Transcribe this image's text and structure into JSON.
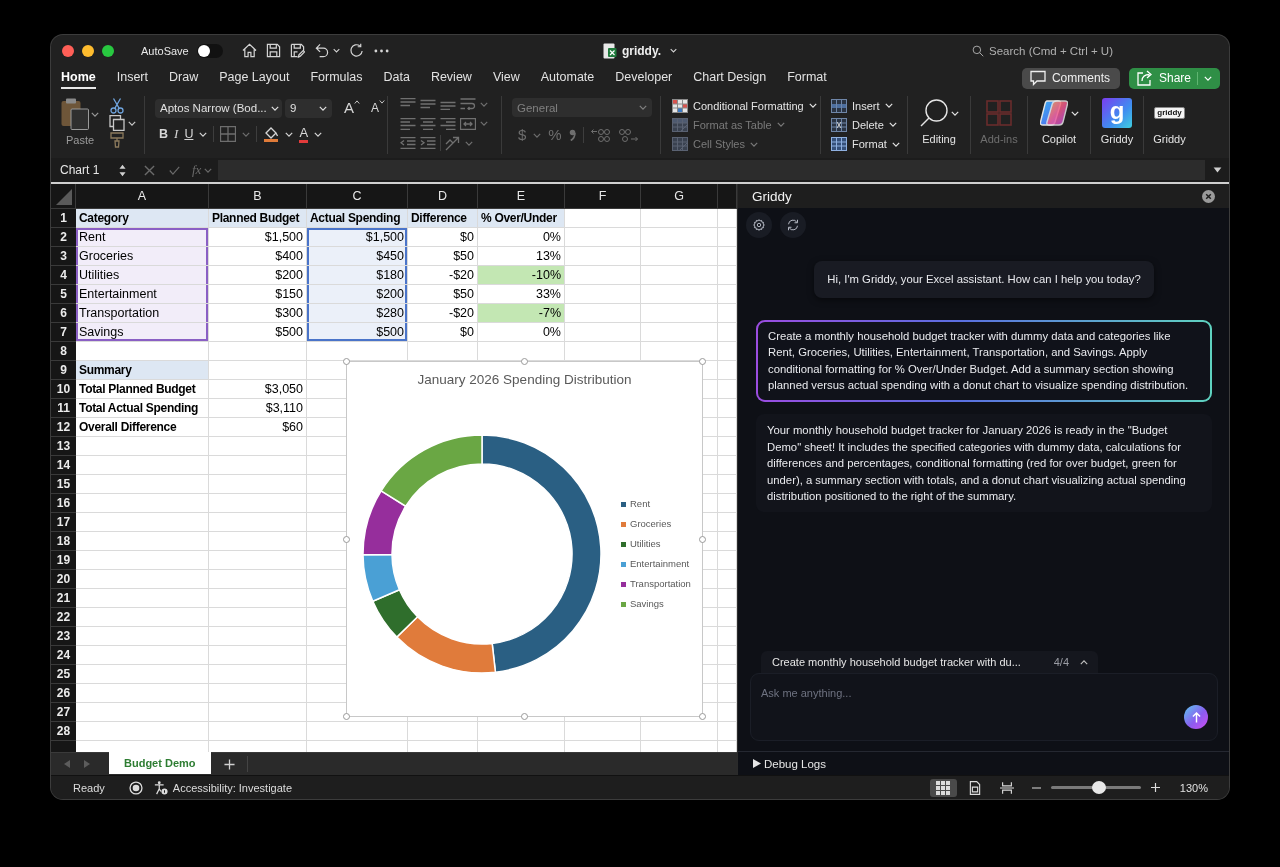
{
  "window": {
    "autosave": {
      "label": "AutoSave",
      "on": false
    },
    "file_name": "griddy.",
    "search": {
      "placeholder": "Search (Cmd + Ctrl + U)"
    }
  },
  "tabs": [
    {
      "label": "Home",
      "selected": true
    },
    {
      "label": "Insert",
      "selected": false
    },
    {
      "label": "Draw",
      "selected": false
    },
    {
      "label": "Page Layout",
      "selected": false
    },
    {
      "label": "Formulas",
      "selected": false
    },
    {
      "label": "Data",
      "selected": false
    },
    {
      "label": "Review",
      "selected": false
    },
    {
      "label": "View",
      "selected": false
    },
    {
      "label": "Automate",
      "selected": false
    },
    {
      "label": "Developer",
      "selected": false
    },
    {
      "label": "Chart Design",
      "selected": false
    },
    {
      "label": "Format",
      "selected": false
    }
  ],
  "header_buttons": {
    "comments": "Comments",
    "share": "Share"
  },
  "ribbon": {
    "clipboard": {
      "paste": "Paste"
    },
    "font": {
      "name": "Aptos Narrow (Bod...",
      "size": "9",
      "grow": "A",
      "shrink": "A",
      "bold": "B",
      "italic": "I",
      "underline": "U",
      "font_color": "A"
    },
    "alignment": {
      "disabled": true
    },
    "number": {
      "format": "General",
      "currency": "$",
      "percent": "%",
      "disabled": true
    },
    "styles": [
      {
        "kind": "conditional",
        "label": "Conditional Formatting",
        "disabled": false
      },
      {
        "kind": "table",
        "label": "Format as Table",
        "disabled": true
      },
      {
        "kind": "cell_styles",
        "label": "Cell Styles",
        "disabled": true
      }
    ],
    "cells": [
      {
        "kind": "insert",
        "label": "Insert"
      },
      {
        "kind": "delete",
        "label": "Delete"
      },
      {
        "kind": "format",
        "label": "Format"
      }
    ],
    "large_buttons": [
      {
        "kind": "editing",
        "label": "Editing",
        "disabled": false
      },
      {
        "kind": "addins",
        "label": "Add-ins",
        "disabled": true
      },
      {
        "kind": "copilot",
        "label": "Copilot",
        "disabled": false
      },
      {
        "kind": "tile",
        "label": "Griddy",
        "tile_letter": "g",
        "disabled": false
      },
      {
        "kind": "logo",
        "label": "Griddy",
        "logo_text": "griddy",
        "disabled": false
      }
    ]
  },
  "formula_bar": {
    "name_box": "Chart 1",
    "function_label": "fx"
  },
  "sheet": {
    "columns": [
      {
        "label": "A",
        "color": "#8a5fc4"
      },
      {
        "label": "B"
      },
      {
        "label": "C",
        "color": "#4a74c9"
      },
      {
        "label": "D"
      },
      {
        "label": "E"
      },
      {
        "label": "F"
      },
      {
        "label": "G"
      }
    ],
    "rows": [
      {
        "number": "1",
        "kind": "header",
        "cells": [
          "Category",
          "Planned Budget",
          "Actual Spending",
          "Difference",
          "% Over/Under"
        ]
      },
      {
        "number": "2",
        "kind": "data",
        "cells": [
          "Rent",
          "$1,500",
          "$1,500",
          "$0",
          "0%"
        ],
        "under_budget": false
      },
      {
        "number": "3",
        "kind": "data",
        "cells": [
          "Groceries",
          "$400",
          "$450",
          "$50",
          "13%"
        ],
        "under_budget": false
      },
      {
        "number": "4",
        "kind": "data",
        "cells": [
          "Utilities",
          "$200",
          "$180",
          "-$20",
          "-10%"
        ],
        "under_budget": true
      },
      {
        "number": "5",
        "kind": "data",
        "cells": [
          "Entertainment",
          "$150",
          "$200",
          "$50",
          "33%"
        ],
        "under_budget": false
      },
      {
        "number": "6",
        "kind": "data",
        "cells": [
          "Transportation",
          "$300",
          "$280",
          "-$20",
          "-7%"
        ],
        "under_budget": true
      },
      {
        "number": "7",
        "kind": "data",
        "cells": [
          "Savings",
          "$500",
          "$500",
          "$0",
          "0%"
        ],
        "under_budget": false
      },
      {
        "number": "8",
        "kind": "blank"
      },
      {
        "number": "9",
        "kind": "section",
        "cells": [
          "Summary"
        ]
      },
      {
        "number": "10",
        "kind": "total",
        "cells": [
          "Total Planned Budget",
          "$3,050"
        ]
      },
      {
        "number": "11",
        "kind": "total",
        "cells": [
          "Total Actual Spending",
          "$3,110"
        ]
      },
      {
        "number": "12",
        "kind": "total",
        "cells": [
          "Overall Difference",
          "$60"
        ]
      },
      {
        "number": "13",
        "kind": "blank"
      },
      {
        "number": "14",
        "kind": "blank"
      },
      {
        "number": "15",
        "kind": "blank"
      },
      {
        "number": "16",
        "kind": "blank"
      },
      {
        "number": "17",
        "kind": "blank"
      },
      {
        "number": "18",
        "kind": "blank"
      },
      {
        "number": "19",
        "kind": "blank"
      },
      {
        "number": "20",
        "kind": "blank"
      },
      {
        "number": "21",
        "kind": "blank"
      },
      {
        "number": "22",
        "kind": "blank"
      },
      {
        "number": "23",
        "kind": "blank"
      },
      {
        "number": "24",
        "kind": "blank"
      },
      {
        "number": "25",
        "kind": "blank"
      },
      {
        "number": "26",
        "kind": "blank"
      },
      {
        "number": "27",
        "kind": "blank"
      },
      {
        "number": "28",
        "kind": "blank"
      },
      {
        "kind": "blank"
      }
    ],
    "chart": {
      "chart_data": {
        "type": "donut",
        "title": "January 2026 Spending Distribution",
        "categories": [
          "Rent",
          "Groceries",
          "Utilities",
          "Entertainment",
          "Transportation",
          "Savings"
        ],
        "values": [
          48.2,
          14.5,
          5.8,
          6.4,
          9.0,
          16.1
        ],
        "colors": [
          "#2a5f83",
          "#e07b3b",
          "#2f6e2c",
          "#4aa0d5",
          "#962e9c",
          "#6aa744"
        ],
        "legend": "right"
      }
    }
  },
  "sheet_tabs": [
    {
      "label": "Budget Demo",
      "selected": true
    }
  ],
  "assistant": {
    "title": "Griddy",
    "messages": [
      {
        "kind": "greeting",
        "text": "Hi, I'm Griddy, your Excel assistant. How can I help you today?"
      },
      {
        "kind": "user",
        "text": "Create a monthly household budget tracker with dummy data and categories like Rent, Groceries, Utilities, Entertainment, Transportation, and Savings. Apply conditional formatting for % Over/Under Budget. Add a summary section showing planned versus actual spending with a donut chart to visualize spending distribution."
      },
      {
        "kind": "assistant",
        "text": "Your monthly household budget tracker for January 2026 is ready in the \"Budget Demo\" sheet! It includes the specified categories with dummy data, calculations for differences and percentages, conditional formatting (red for over budget, green for under), a summary section with totals, and a donut chart visualizing actual spending distribution positioned to the right of the summary."
      }
    ],
    "history": {
      "preview": "Create monthly household budget tracker with du...",
      "counter": "4/4"
    },
    "input": {
      "placeholder": "Ask me anything..."
    },
    "debug_logs": {
      "label": "Debug Logs",
      "expanded": false
    }
  },
  "status_bar": {
    "ready": "Ready",
    "accessibility": "Accessibility: Investigate",
    "views": [
      {
        "kind": "normal",
        "selected": true
      },
      {
        "kind": "page_layout",
        "selected": false
      },
      {
        "kind": "page_break",
        "selected": false
      }
    ],
    "zoom": {
      "level": 0.53,
      "reading": "130%"
    }
  }
}
